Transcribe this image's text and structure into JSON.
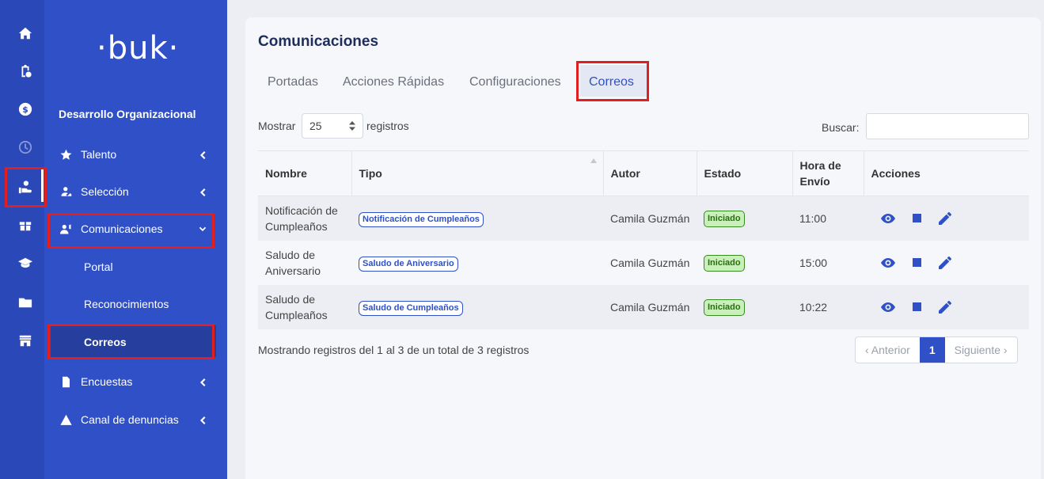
{
  "rail": {
    "icons": [
      "home-icon",
      "clipboard-clock-icon",
      "dollar-icon",
      "clock-icon",
      "hand-user-icon",
      "gift-icon",
      "graduation-cap-icon",
      "folder-icon",
      "store-icon"
    ]
  },
  "sidebar": {
    "logo": "·buk·",
    "section_title": "Desarrollo Organizacional",
    "items": [
      {
        "label": "Talento",
        "icon": "star-icon"
      },
      {
        "label": "Selección",
        "icon": "user-handshake-icon"
      },
      {
        "label": "Comunicaciones",
        "icon": "users-voice-icon"
      },
      {
        "label": "Encuestas",
        "icon": "file-icon"
      },
      {
        "label": "Canal de denuncias",
        "icon": "warning-icon"
      }
    ],
    "subitems": [
      {
        "label": "Portal"
      },
      {
        "label": "Reconocimientos"
      },
      {
        "label": "Correos"
      }
    ]
  },
  "main": {
    "title": "Comunicaciones",
    "tabs": [
      "Portadas",
      "Acciones Rápidas",
      "Configuraciones",
      "Correos"
    ],
    "active_tab": "Correos",
    "show_label": "Mostrar",
    "page_size": "25",
    "records_label": "registros",
    "search_label": "Buscar:",
    "search_value": "",
    "table": {
      "headers": [
        "Nombre",
        "Tipo",
        "Autor",
        "Estado",
        "Hora de Envío",
        "Acciones"
      ],
      "rows": [
        {
          "nombre": "Notificación de Cumpleaños",
          "tipo": "Notificación de Cumpleaños",
          "autor": "Camila Guzmán",
          "estado": "Iniciado",
          "hora": "11:00"
        },
        {
          "nombre": "Saludo de Aniversario",
          "tipo": "Saludo de Aniversario",
          "autor": "Camila Guzmán",
          "estado": "Iniciado",
          "hora": "15:00"
        },
        {
          "nombre": "Saludo de Cumpleaños",
          "tipo": "Saludo de Cumpleaños",
          "autor": "Camila Guzmán",
          "estado": "Iniciado",
          "hora": "10:22"
        }
      ]
    },
    "footer": "Mostrando registros del 1 al 3 de un total de 3 registros",
    "pagination": {
      "prev": "Anterior",
      "current": "1",
      "next": "Siguiente"
    }
  },
  "colors": {
    "brand": "#2f50c6",
    "rail": "#2b48b8",
    "highlight": "#e02020",
    "status_green": "#c9f0b8"
  }
}
